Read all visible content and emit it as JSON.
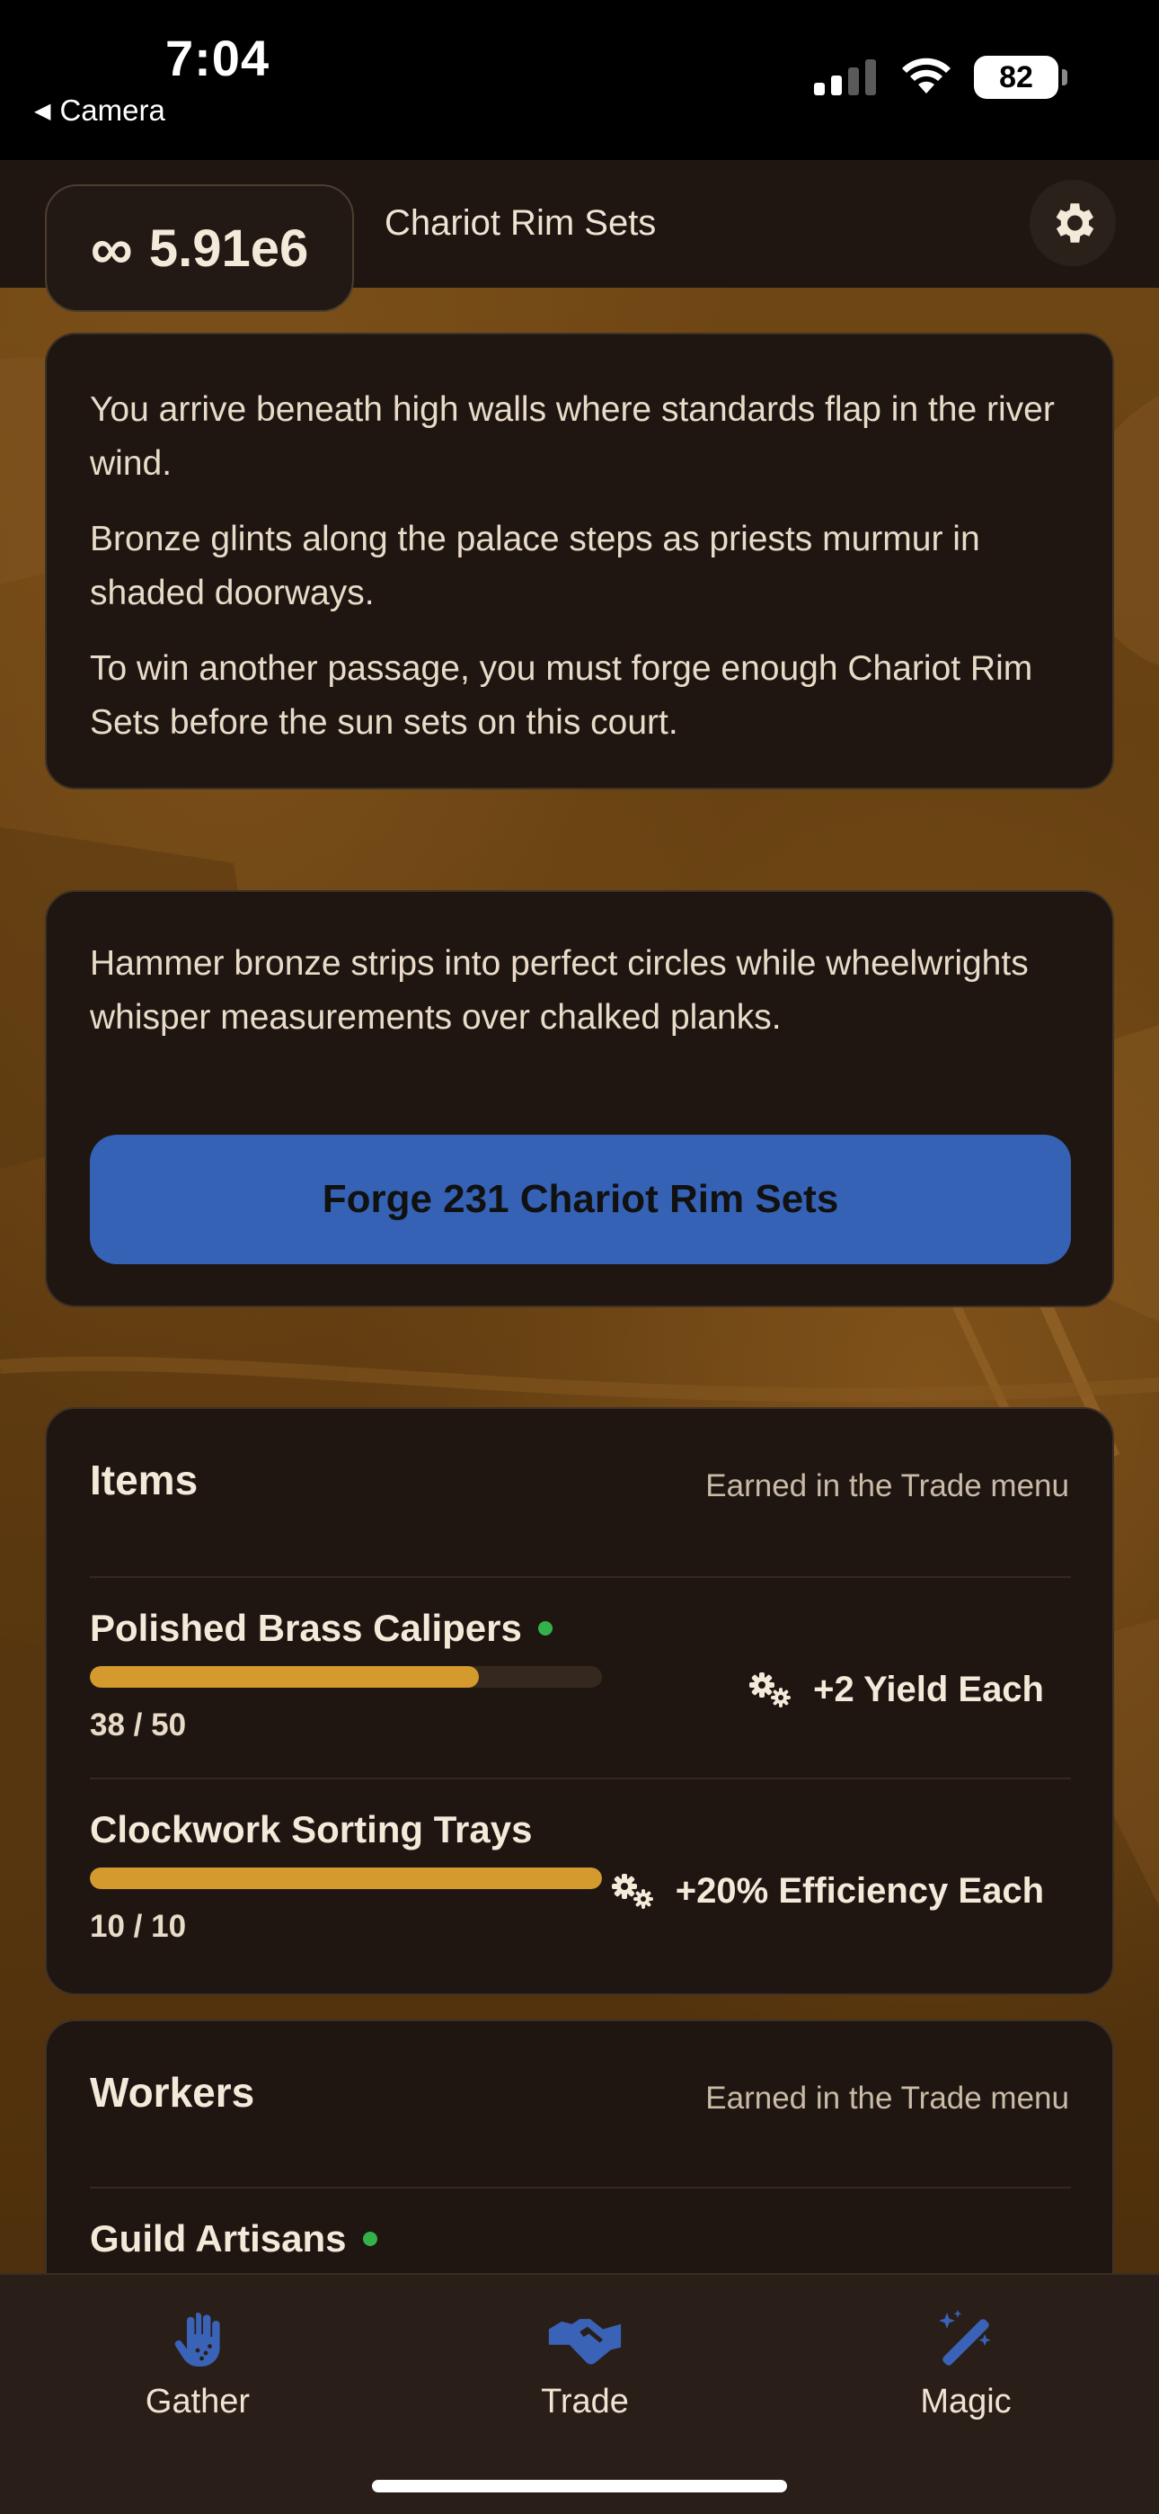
{
  "status_bar": {
    "time": "7:04",
    "back_app": "Camera",
    "battery": "82"
  },
  "header": {
    "currency_symbol": "∞",
    "currency_value": "5.91e6",
    "title": "Chariot Rim Sets",
    "settings_icon": "gear-icon"
  },
  "story": {
    "paragraphs": [
      "You arrive beneath high walls where standards flap in the river wind.",
      "Bronze glints along the palace steps as priests murmur in shaded doorways.",
      "To win another passage, you must forge enough Chariot Rim Sets before the sun sets on this court."
    ]
  },
  "forge": {
    "description": "Hammer bronze strips into perfect circles while wheelwrights whisper measurements over chalked planks.",
    "button_label": "Forge 231 Chariot Rim Sets",
    "button_color": "#3562b5"
  },
  "items": {
    "title": "Items",
    "note": "Earned in the Trade menu",
    "rows": [
      {
        "name": "Polished Brass Calipers",
        "active": true,
        "count": "38 / 50",
        "progress": 0.76,
        "bonus": "+2 Yield Each",
        "bonus_icon": "gears-icon"
      },
      {
        "name": "Clockwork Sorting Trays",
        "active": false,
        "count": "10 / 10",
        "progress": 1.0,
        "bonus": "+20% Efficiency Each",
        "bonus_icon": "gears-icon"
      }
    ]
  },
  "workers": {
    "title": "Workers",
    "note": "Earned in the Trade menu",
    "rows": [
      {
        "name": "Guild Artisans",
        "active": true
      }
    ]
  },
  "nav": {
    "items": [
      {
        "label": "Gather",
        "icon": "hand-icon"
      },
      {
        "label": "Trade",
        "icon": "handshake-icon"
      },
      {
        "label": "Magic",
        "icon": "magic-wand-icon"
      }
    ],
    "accent": "#3a63b8"
  },
  "colors": {
    "progress_fill": "#d49a2e",
    "active_dot": "#35b14a",
    "card_bg": "#1f1612"
  }
}
